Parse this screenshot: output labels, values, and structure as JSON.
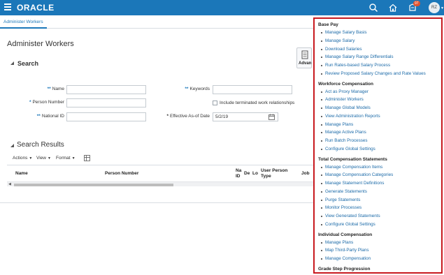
{
  "header": {
    "brand": "ORACLE",
    "notification_count": "97",
    "user_initials": "RZ",
    "icons": [
      "menu-icon",
      "search-icon",
      "home-icon",
      "notifications-icon",
      "user-menu-chevron-icon"
    ]
  },
  "tabs": [
    {
      "label": "Administer Workers",
      "active": true
    }
  ],
  "page": {
    "title": "Administer Workers"
  },
  "search": {
    "section_title": "Search",
    "advanced_label": "Advan",
    "fields": {
      "name_label": "Name",
      "keywords_label": "Keywords",
      "person_number_label": "Person Number",
      "include_terminated_label": "Include terminated work relationships",
      "national_id_label": "National ID",
      "effective_date_label": "Effective As-of Date",
      "effective_date_value": "5/2/19"
    }
  },
  "results": {
    "section_title": "Search Results",
    "toolbar": {
      "actions": "Actions",
      "view": "View",
      "format": "Format"
    },
    "columns": {
      "name": "Name",
      "person_number": "Person Number",
      "national_id_a": "Na",
      "national_id_b": "ID",
      "de": "De",
      "lo": "Lo",
      "user_person_type_a": "User Person",
      "user_person_type_b": "Type",
      "job": "Job"
    }
  },
  "task_panel": {
    "groups": [
      {
        "title": "Base Pay",
        "items": [
          "Manage Salary Basis",
          "Manage Salary",
          "Download Salaries",
          "Manage Salary Range Differentials",
          "Run Rates-based Salary Process",
          "Review Proposed Salary Changes and Rate Values"
        ]
      },
      {
        "title": "Workforce Compensation",
        "items": [
          "Act as Proxy Manager",
          "Administer Workers",
          "Manage Global Models",
          "View Administration Reports",
          "Manage Plans",
          "Manage Active Plans",
          "Run Batch Processes",
          "Configure Global Settings"
        ]
      },
      {
        "title": "Total Compensation Statements",
        "items": [
          "Manage Compensation Items",
          "Manage Compensation Categories",
          "Manage Statement Definitions",
          "Generate Statements",
          "Purge Statements",
          "Monitor Processes",
          "View Generated Statements",
          "Configure Global Settings"
        ]
      },
      {
        "title": "Individual Compensation",
        "items": [
          "Manage Plans",
          "Map Third-Party Plans",
          "Manage Compensation"
        ]
      },
      {
        "title": "Grade Step Progression",
        "items": []
      }
    ]
  },
  "colors": {
    "header_bg": "#1b77b9",
    "link": "#1b6aa8",
    "panel_border": "#c8191f",
    "badge": "#e0522e"
  }
}
